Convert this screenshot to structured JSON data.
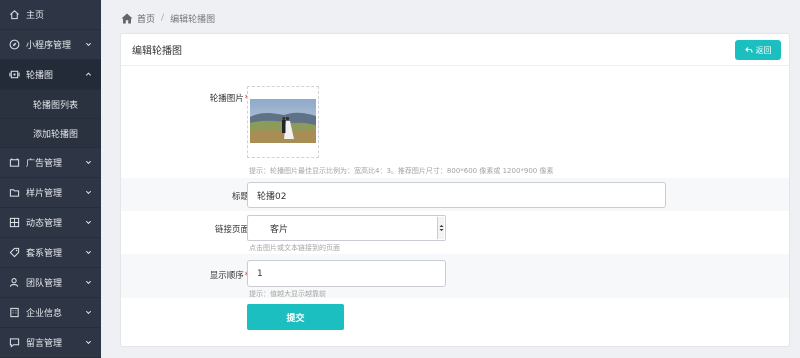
{
  "sidebar": {
    "items": [
      {
        "label": "主页",
        "icon": "home-icon",
        "chevron": false
      },
      {
        "label": "小程序管理",
        "icon": "compass-icon",
        "chevron": true
      },
      {
        "label": "轮播图",
        "icon": "slides-icon",
        "chevron": true,
        "expanded": true
      },
      {
        "label": "广告管理",
        "icon": "ad-icon",
        "chevron": true
      },
      {
        "label": "样片管理",
        "icon": "folder-icon",
        "chevron": true
      },
      {
        "label": "动态管理",
        "icon": "grid-icon",
        "chevron": true
      },
      {
        "label": "套系管理",
        "icon": "tag-icon",
        "chevron": true
      },
      {
        "label": "团队管理",
        "icon": "user-icon",
        "chevron": true
      },
      {
        "label": "企业信息",
        "icon": "building-icon",
        "chevron": true
      },
      {
        "label": "留言管理",
        "icon": "message-icon",
        "chevron": true
      }
    ],
    "sub_items": [
      "轮播图列表",
      "添加轮播图"
    ]
  },
  "breadcrumb": {
    "home": "首页",
    "current": "编辑轮播图",
    "separator": "/"
  },
  "card": {
    "title": "编辑轮播图",
    "back_label": "返回"
  },
  "form": {
    "image": {
      "label": "轮播图片",
      "required": "*",
      "hint": "提示：轮播图片最佳显示比例为：宽高比4：3。推荐图片尺寸：800*600 像素或 1200*900 像素"
    },
    "title": {
      "label": "标题",
      "value": "轮播02"
    },
    "link": {
      "label": "链接页面",
      "selected": "客片",
      "hint": "点击图片或文本链接到的页面"
    },
    "order": {
      "label": "显示顺序",
      "required": "*",
      "value": "1",
      "hint": "提示：值越大显示越靠前"
    },
    "submit_label": "提交"
  },
  "colors": {
    "accent": "#1bbfbf",
    "sidebar": "#2e3646",
    "required": "#d9363e"
  }
}
